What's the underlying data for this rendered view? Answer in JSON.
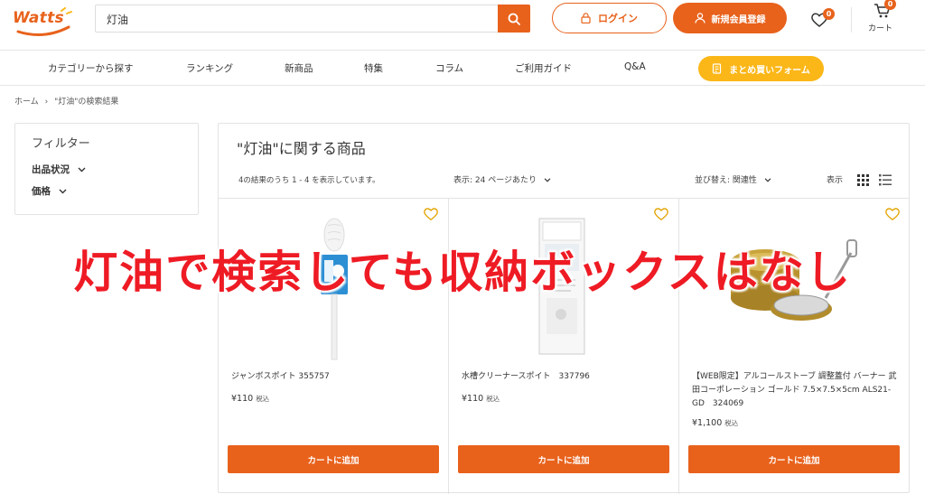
{
  "header": {
    "logo_text": "Watts",
    "search_value": "灯油",
    "login_label": "ログイン",
    "register_label": "新規会員登録",
    "wishlist_count": "0",
    "cart_count": "0",
    "cart_label": "カート"
  },
  "nav": {
    "items": [
      "カテゴリーから探す",
      "ランキング",
      "新商品",
      "特集",
      "コラム",
      "ご利用ガイド",
      "Q&A"
    ],
    "bulk_order_label": "まとめ買いフォーム"
  },
  "breadcrumb": {
    "home": "ホーム",
    "separator": "›",
    "current": "\"灯油\"の検索結果"
  },
  "filter": {
    "title": "フィルター",
    "options": [
      "出品状況",
      "価格"
    ]
  },
  "results": {
    "title": "\"灯油\"に関する商品",
    "count_text": "4の結果のうち 1 - 4 を表示しています。",
    "per_page_text": "表示: 24 ページあたり",
    "sort_text": "並び替え: 関連性",
    "view_label": "表示",
    "products": [
      {
        "name": "ジャンボスポイト 355757",
        "price": "¥110",
        "tax": "税込",
        "button": "カートに追加"
      },
      {
        "name": "水槽クリーナースポイト　337796",
        "price": "¥110",
        "tax": "税込",
        "button": "カートに追加"
      },
      {
        "name": "【WEB限定】アルコールストーブ 調整蓋付 バーナー 武田コーポレーション ゴールド 7.5×7.5×5cm ALS21-GD　324069",
        "price": "¥1,100",
        "tax": "税込",
        "button": "カートに追加"
      }
    ]
  },
  "overlay_caption": "灯油で検索しても収納ボックスはなし",
  "colors": {
    "accent": "#e8621c",
    "bulk_button": "#fbb718",
    "caption": "#ee1b24"
  }
}
